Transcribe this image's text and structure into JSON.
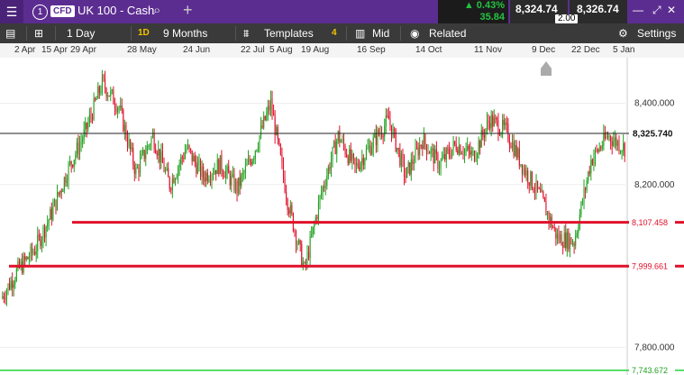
{
  "header": {
    "menu_icon": "hamburger-icon",
    "info_label": "1",
    "cfd_badge": "CFD",
    "market_name": "UK 100 - Cash",
    "search_icon": "search-icon",
    "add_icon": "plus-icon",
    "change_pct": "▲ 0.43%",
    "change_pts": "35.84",
    "sell_price": "8,324.74",
    "spread": "2.00",
    "buy_price": "8,326.74",
    "window_buttons": [
      "minimize-icon",
      "expand-icon",
      "collapse-icon",
      "close-icon"
    ]
  },
  "toolbar": {
    "interval": "1 Day",
    "interval_badge": "1D",
    "range": "9 Months",
    "templates": "Templates",
    "templates_count": "4",
    "price_type": "Mid",
    "related": "Related",
    "settings": "Settings"
  },
  "date_axis": [
    "2 Apr",
    "15 Apr",
    "29 Apr",
    "28 May",
    "24 Jun",
    "22 Jul",
    "5 Aug",
    "19 Aug",
    "16 Sep",
    "14 Oct",
    "11 Nov",
    "9 Dec",
    "22 Dec",
    "5 Jan"
  ],
  "colors": {
    "up": "#1fa01f",
    "down": "#e0102a",
    "support": "#e0102a",
    "low_line": "#25d43a",
    "current": "#222222",
    "header_bg": "#5c2d91"
  },
  "chart_data": {
    "type": "candlestick",
    "y_range": [
      7732,
      8512
    ],
    "y_ticks": [
      "8,400.000",
      "8,200.000",
      "7,800.000"
    ],
    "horizontal_lines": [
      {
        "label": "8,325.740",
        "value": 8325.74,
        "kind": "current"
      },
      {
        "label": "8,107.458",
        "value": 8107.458,
        "kind": "support"
      },
      {
        "label": "7,999.661",
        "value": 7999.661,
        "kind": "support"
      },
      {
        "label": "7,743.672",
        "value": 7743.672,
        "kind": "low"
      }
    ],
    "series": [
      {
        "segment": 1,
        "points": [
          [
            7920,
            7990
          ],
          [
            7990,
            8040
          ],
          [
            8040,
            8130
          ],
          [
            8130,
            8240
          ],
          [
            8240,
            8330
          ],
          [
            8330,
            8450
          ],
          [
            8450,
            8390
          ],
          [
            8390,
            8230
          ]
        ]
      },
      {
        "segment": 2,
        "points": [
          [
            8230,
            8320
          ],
          [
            8320,
            8200
          ],
          [
            8200,
            8290
          ],
          [
            8290,
            8220
          ],
          [
            8220,
            8250
          ],
          [
            8250,
            8190
          ],
          [
            8190,
            8280
          ]
        ]
      },
      {
        "segment": 3,
        "points": [
          [
            8280,
            8400
          ],
          [
            8400,
            8160
          ],
          [
            8160,
            7990
          ],
          [
            7990,
            8180
          ],
          [
            8180,
            8320
          ],
          [
            8320,
            8240
          ],
          [
            8240,
            8300
          ],
          [
            8300,
            8360
          ]
        ]
      },
      {
        "segment": 4,
        "points": [
          [
            8360,
            8220
          ],
          [
            8220,
            8310
          ],
          [
            8310,
            8250
          ],
          [
            8250,
            8300
          ],
          [
            8300,
            8270
          ],
          [
            8270,
            8360
          ],
          [
            8360,
            8330
          ]
        ]
      },
      {
        "segment": 5,
        "points": [
          [
            8330,
            8240
          ],
          [
            8240,
            8170
          ],
          [
            8170,
            8070
          ],
          [
            8070,
            8060
          ],
          [
            8060,
            8260
          ],
          [
            8260,
            8320
          ],
          [
            8320,
            8290
          ]
        ]
      }
    ]
  }
}
